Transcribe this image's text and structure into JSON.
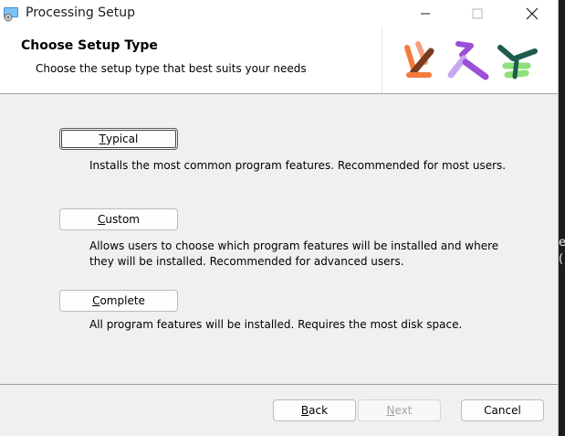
{
  "window": {
    "title": "Processing Setup",
    "app_icon": "installer-icon",
    "caption_buttons": [
      "minimize-icon",
      "maximize-icon",
      "close-icon"
    ]
  },
  "banner": {
    "title": "Choose Setup Type",
    "subtitle": "Choose the setup type that best suits your needs",
    "logo": "processing-logo"
  },
  "options": [
    {
      "label_prefix": "",
      "label_mnemonic": "T",
      "label_rest": "ypical",
      "description": "Installs the most common program features. Recommended for most users.",
      "focused": true
    },
    {
      "label_prefix": "",
      "label_mnemonic": "C",
      "label_rest": "ustom",
      "description": "Allows users to choose which program features will be installed and where they will be installed. Recommended for advanced users.",
      "focused": false
    },
    {
      "label_prefix": "",
      "label_mnemonic": "C",
      "label_rest": "omplete",
      "description": "All program features will be installed. Requires the most disk space.",
      "focused": false
    }
  ],
  "footer": {
    "back": {
      "mnemonic": "B",
      "rest": "ack",
      "enabled": true
    },
    "next": {
      "mnemonic": "N",
      "rest": "ext",
      "enabled": false
    },
    "cancel": {
      "label": "Cancel",
      "enabled": true
    }
  },
  "background_peek": [
    "e",
    "("
  ],
  "colors": {
    "logo_orange": "#f47a3c",
    "logo_brown": "#7a3b1f",
    "logo_purple": "#9b4fd6",
    "logo_lilac": "#c9a7f2",
    "logo_green": "#8ee07a",
    "logo_teal": "#1f5b4e"
  }
}
